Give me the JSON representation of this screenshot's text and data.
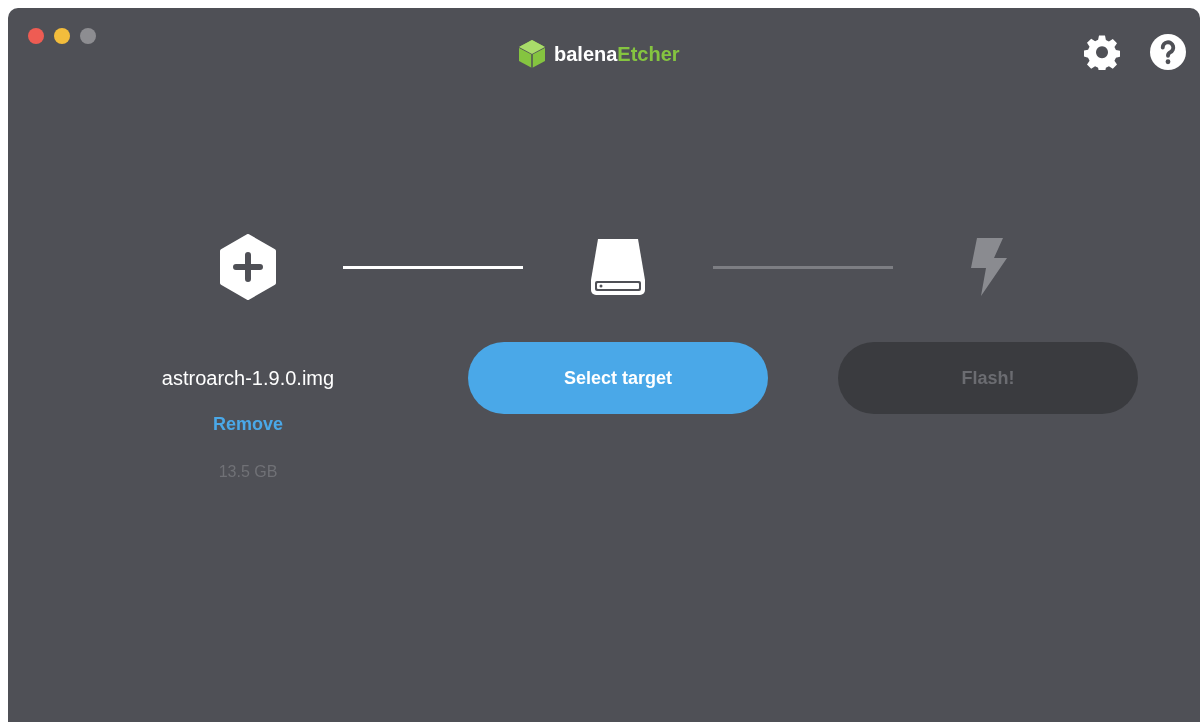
{
  "window": {
    "title": "balena**Etcher**",
    "controls": [
      {
        "color": "#ee5c53"
      },
      {
        "color": "#f3bd3c"
      },
      {
        "color": "#8d8d91"
      }
    ]
  },
  "toolbar": [
    {
      "kind": "settings"
    },
    {
      "kind": "help"
    }
  ],
  "steps": [
    {
      "kind": "image",
      "disabled": false,
      "file_name": "astroarch-1.9.0.img",
      "action": "Remove",
      "size": "13.5 GB"
    },
    {
      "kind": "drive",
      "disabled": false,
      "button": "Select target"
    },
    {
      "kind": "flash",
      "disabled": true,
      "button": "Flash!"
    }
  ],
  "connectors": [
    {
      "active": true
    },
    {
      "active": false
    }
  ]
}
